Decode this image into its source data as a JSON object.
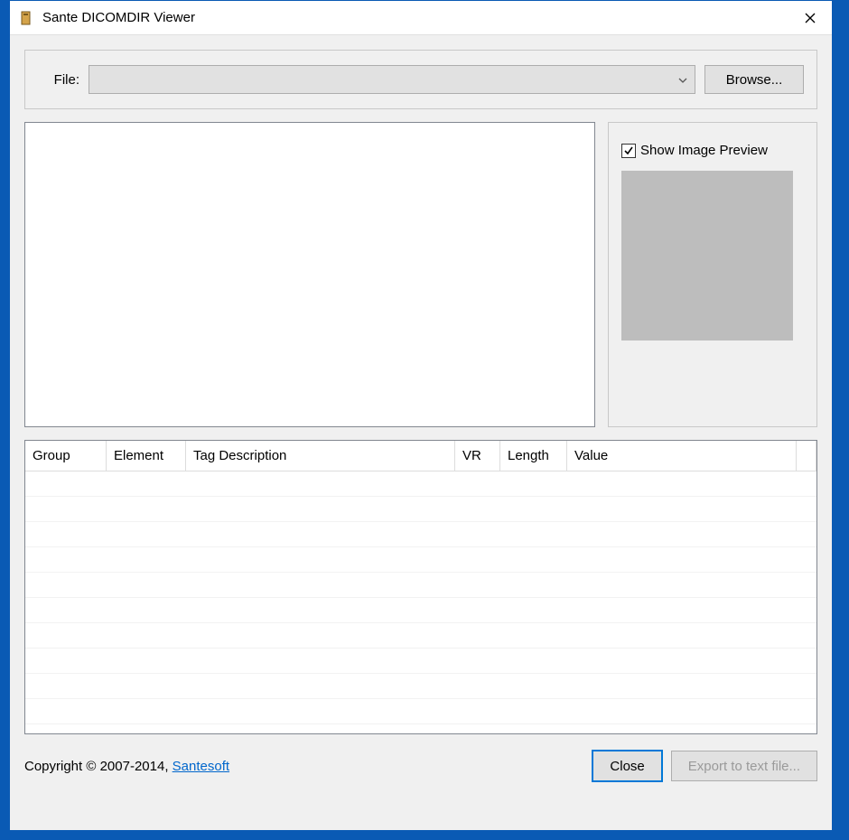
{
  "window": {
    "title": "Sante DICOMDIR Viewer"
  },
  "fileRow": {
    "label": "File:",
    "combo_value": "",
    "browse_label": "Browse..."
  },
  "preview": {
    "checkbox_label": "Show Image Preview",
    "checked": true
  },
  "table": {
    "columns": {
      "group": "Group",
      "element": "Element",
      "tagdesc": "Tag Description",
      "vr": "VR",
      "length": "Length",
      "value": "Value"
    }
  },
  "footer": {
    "copyright_prefix": "Copyright © 2007-2014, ",
    "link_text": "Santesoft",
    "close_label": "Close",
    "export_label": "Export to text file..."
  }
}
